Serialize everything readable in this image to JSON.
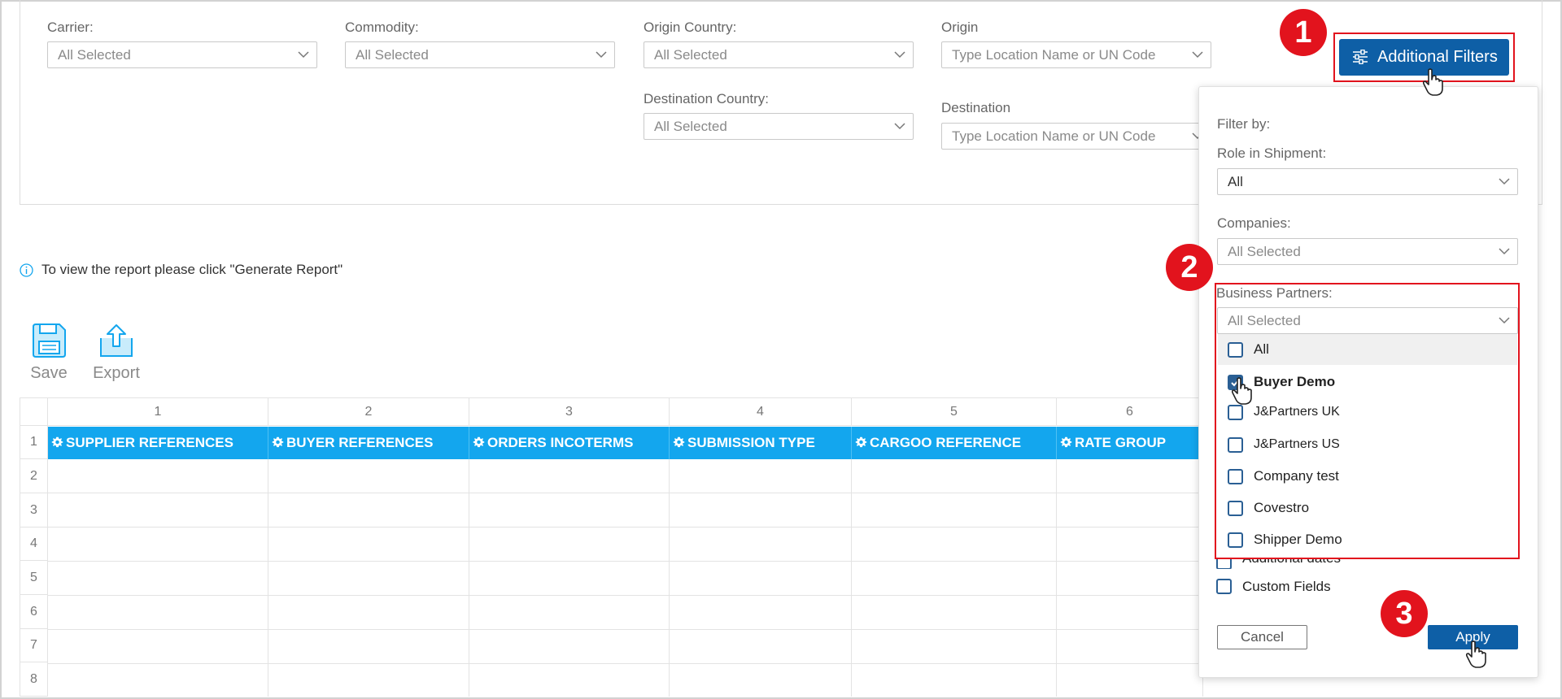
{
  "filters": {
    "carrier": {
      "label": "Carrier:",
      "value": "All Selected"
    },
    "commodity": {
      "label": "Commodity:",
      "value": "All Selected"
    },
    "origin_country": {
      "label": "Origin Country:",
      "value": "All Selected"
    },
    "origin": {
      "label": "Origin",
      "placeholder": "Type Location Name or UN Code"
    },
    "destination_country": {
      "label": "Destination Country:",
      "value": "All Selected"
    },
    "destination": {
      "label": "Destination",
      "placeholder": "Type Location Name or UN Code"
    }
  },
  "additional_filters_button": {
    "label": "Additional Filters",
    "icon": "sliders-icon"
  },
  "step_badges": [
    "1",
    "2",
    "3"
  ],
  "info": {
    "text": "To view the report please click \"Generate Report\"",
    "icon": "info-icon"
  },
  "toolbar": {
    "save_label": "Save",
    "export_label": "Export"
  },
  "grid": {
    "column_numbers": [
      "1",
      "2",
      "3",
      "4",
      "5",
      "6"
    ],
    "row_numbers": [
      "1",
      "2",
      "3",
      "4",
      "5",
      "6",
      "7",
      "8"
    ],
    "headers": [
      "SUPPLIER REFERENCES",
      "BUYER REFERENCES",
      "ORDERS INCOTERMS",
      "SUBMISSION TYPE",
      "CARGOO REFERENCE",
      "RATE GROUP"
    ],
    "header_color": "#13a6ee"
  },
  "popover": {
    "filter_by": "Filter by:",
    "role": {
      "label": "Role in Shipment:",
      "value": "All"
    },
    "companies": {
      "label": "Companies:",
      "value": "All Selected"
    },
    "business_partners": {
      "label": "Business Partners:",
      "value": "All Selected",
      "options": [
        {
          "label": "All",
          "checked": false
        },
        {
          "label": "Buyer Demo",
          "checked": true
        },
        {
          "label": "J&Partners UK",
          "checked": false
        },
        {
          "label": "J&Partners US",
          "checked": false
        },
        {
          "label": "Company test",
          "checked": false
        },
        {
          "label": "Covestro",
          "checked": false
        },
        {
          "label": "Shipper Demo",
          "checked": false
        }
      ]
    },
    "extra_options": [
      "Additional dates",
      "Custom Fields"
    ],
    "cancel_label": "Cancel",
    "apply_label": "Apply"
  },
  "colors": {
    "primary": "#0e5fa6",
    "highlight": "#e2131d",
    "checkbox": "#2a5f94"
  }
}
